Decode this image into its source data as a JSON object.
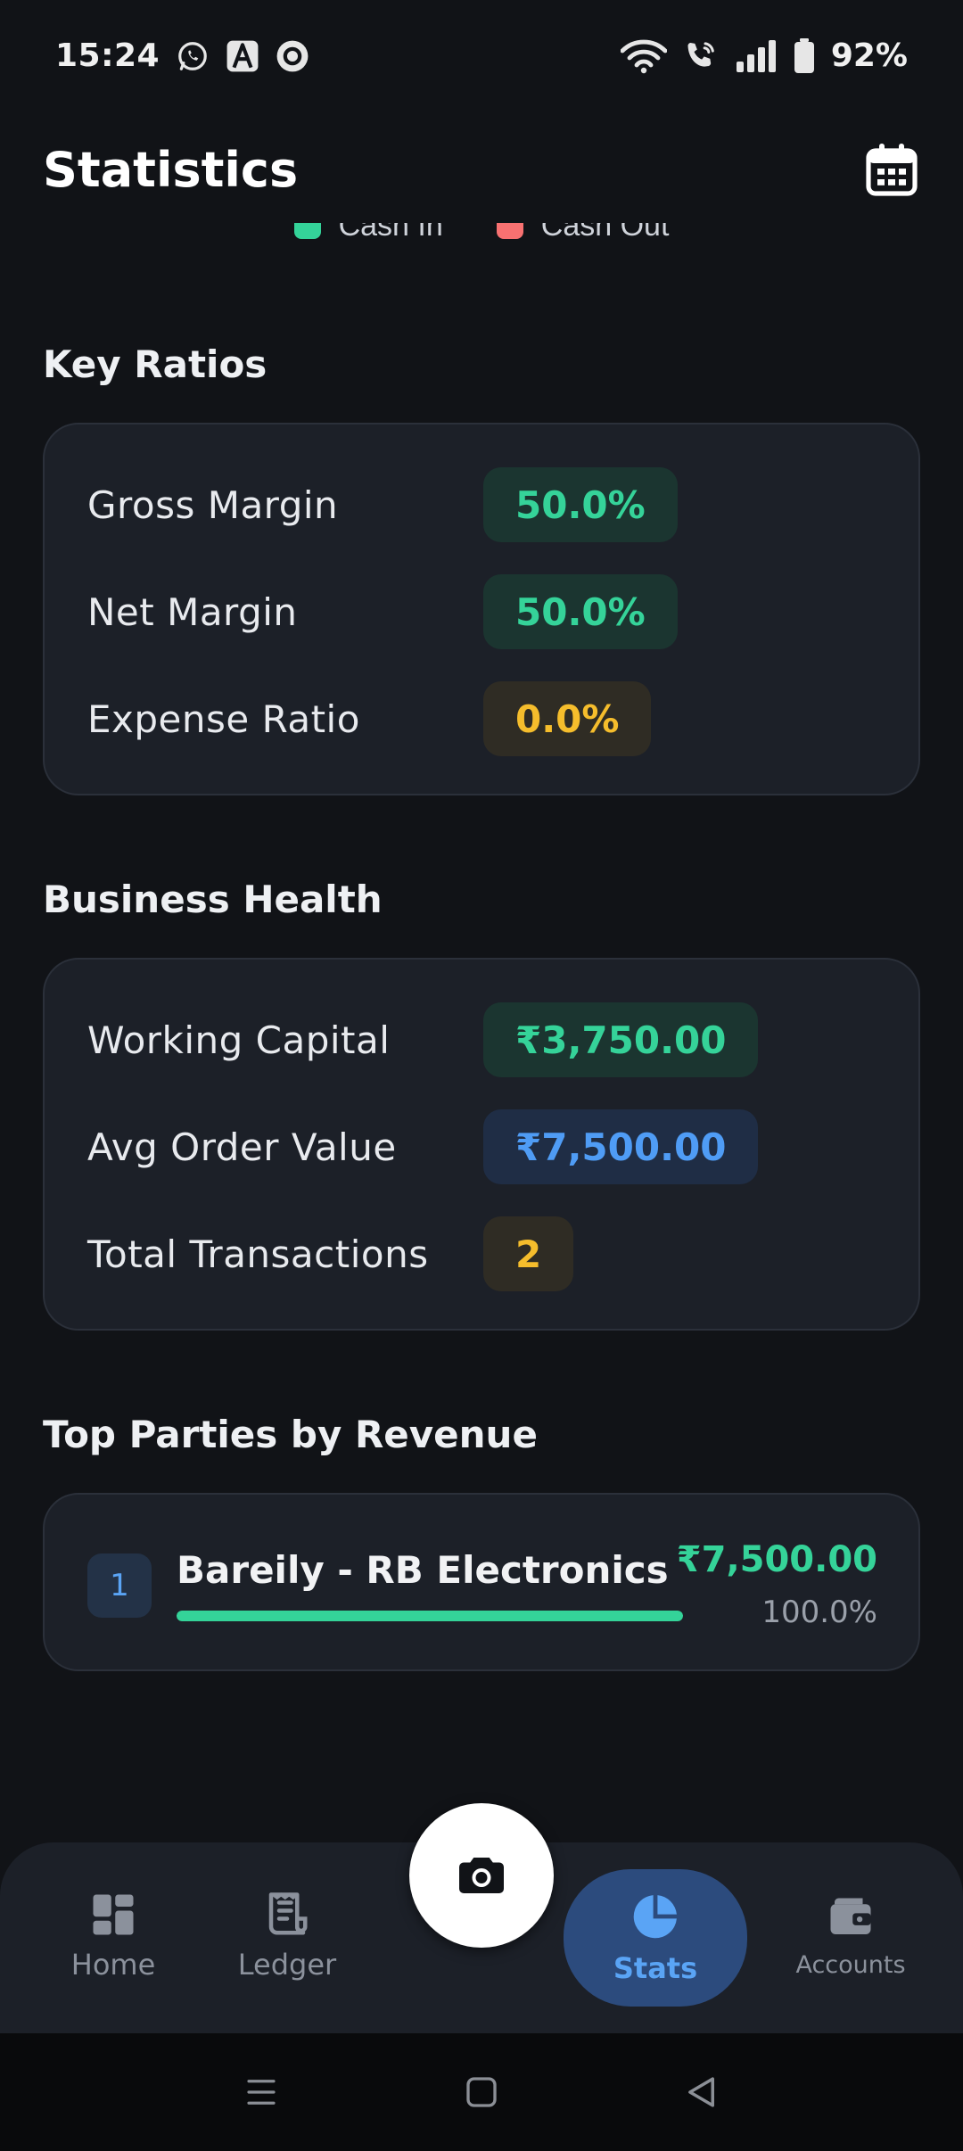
{
  "status_bar": {
    "time": "15:24",
    "battery": "92%",
    "icons": [
      "whatsapp-icon",
      "app-a-icon",
      "record-icon",
      "wifi-icon",
      "wifi-call-icon",
      "signal-icon",
      "battery-icon"
    ]
  },
  "header": {
    "title": "Statistics",
    "calendar_icon": "calendar-icon"
  },
  "legend": {
    "items": [
      {
        "label": "Cash In",
        "color": "#34d399"
      },
      {
        "label": "Cash Out",
        "color": "#f87171"
      }
    ]
  },
  "key_ratios": {
    "title": "Key Ratios",
    "rows": [
      {
        "label": "Gross Margin",
        "value": "50.0%",
        "tone": "green"
      },
      {
        "label": "Net Margin",
        "value": "50.0%",
        "tone": "green"
      },
      {
        "label": "Expense Ratio",
        "value": "0.0%",
        "tone": "amber"
      }
    ]
  },
  "business_health": {
    "title": "Business Health",
    "rows": [
      {
        "label": "Working Capital",
        "value": "₹3,750.00",
        "tone": "green"
      },
      {
        "label": "Avg Order Value",
        "value": "₹7,500.00",
        "tone": "blue"
      },
      {
        "label": "Total Transactions",
        "value": "2",
        "tone": "amber"
      }
    ]
  },
  "top_parties": {
    "title": "Top Parties by Revenue",
    "items": [
      {
        "rank": "1",
        "name": "Bareily - RB Electronics",
        "amount": "₹7,500.00",
        "percent": "100.0%",
        "share": 1.0
      }
    ]
  },
  "bottom_nav": {
    "items": [
      {
        "label": "Home",
        "icon": "dashboard-icon",
        "active": false
      },
      {
        "label": "Ledger",
        "icon": "receipt-icon",
        "active": false
      },
      {
        "label": "Stats",
        "icon": "pie-chart-icon",
        "active": true
      },
      {
        "label": "Accounts",
        "icon": "wallet-icon",
        "active": false
      }
    ],
    "fab_icon": "camera-icon"
  },
  "colors": {
    "background": "#111317",
    "card": "#1c2028",
    "green": "#34d399",
    "amber": "#f5bd2c",
    "blue": "#4f9cf5",
    "red": "#f87171"
  }
}
